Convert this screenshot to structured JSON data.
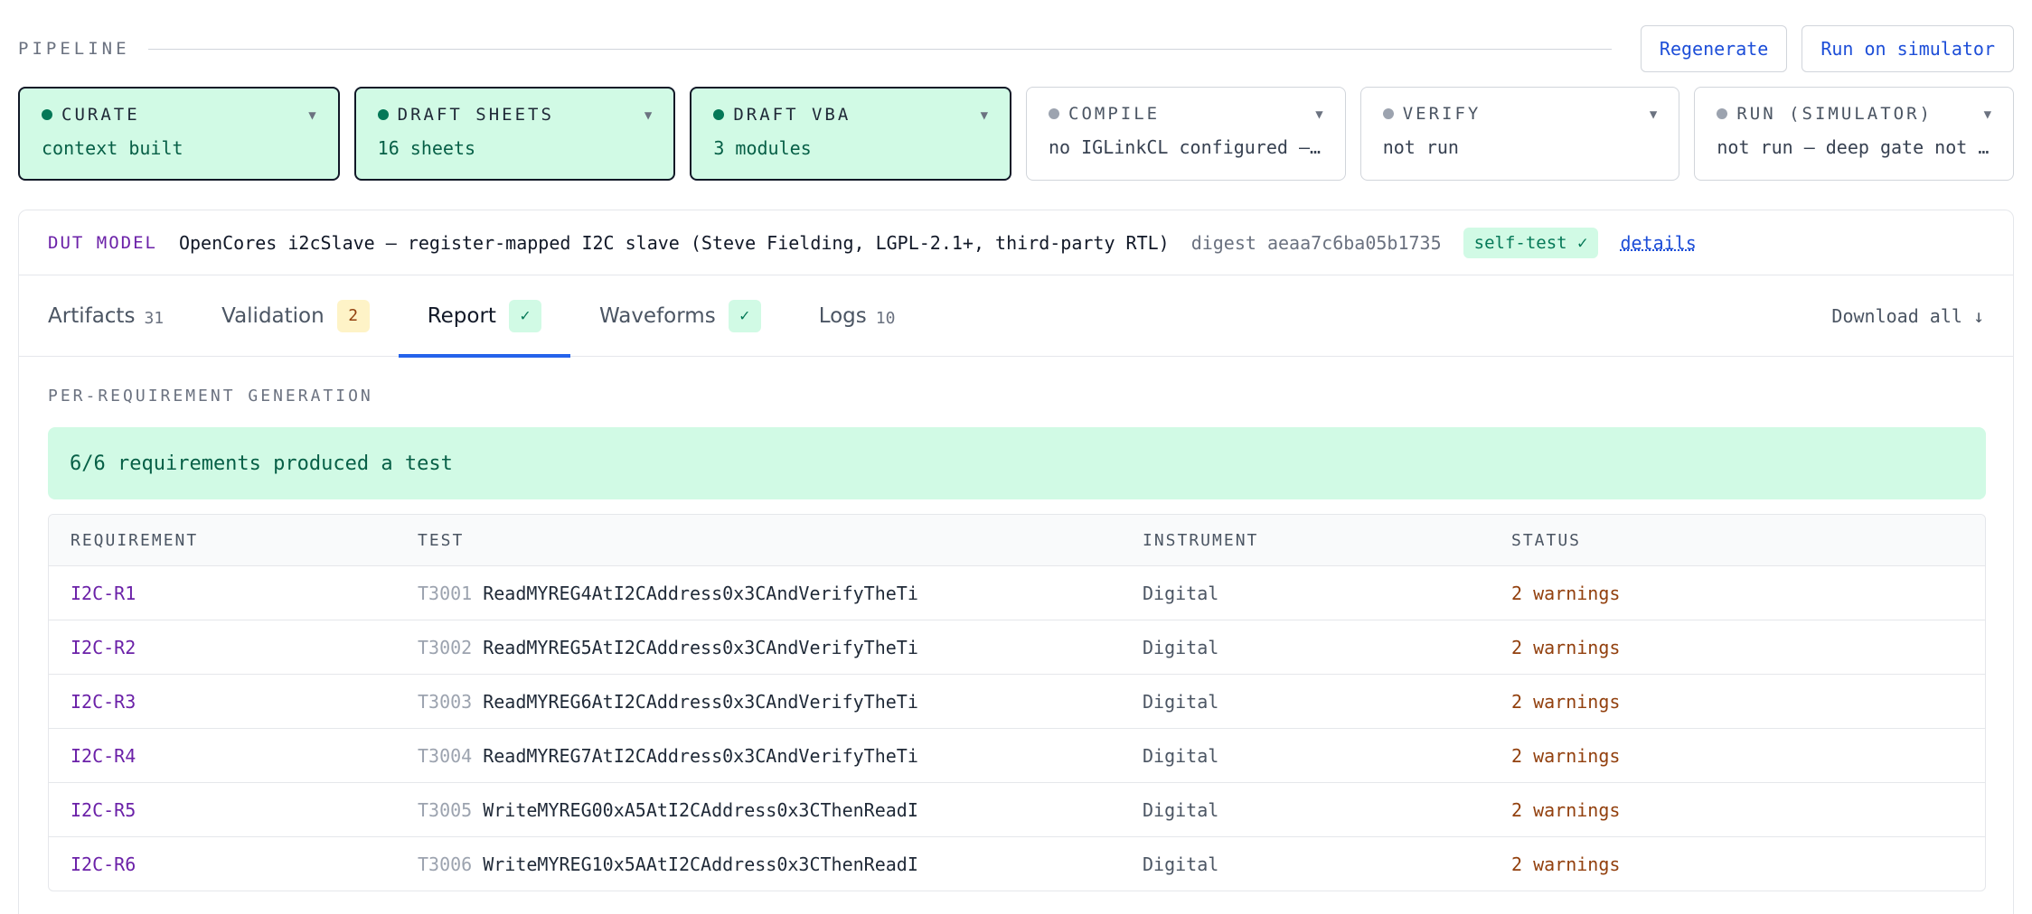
{
  "pipeline": {
    "label": "PIPELINE",
    "regenerate_label": "Regenerate",
    "run_label": "Run on simulator"
  },
  "stages": [
    {
      "name": "CURATE",
      "sub": "context built",
      "state": "done"
    },
    {
      "name": "DRAFT SHEETS",
      "sub": "16 sheets",
      "state": "done"
    },
    {
      "name": "DRAFT VBA",
      "sub": "3 modules",
      "state": "done"
    },
    {
      "name": "COMPILE",
      "sub": "no IGLinkCL configured —…",
      "state": "pending"
    },
    {
      "name": "VERIFY",
      "sub": "not run",
      "state": "pending"
    },
    {
      "name": "RUN (SIMULATOR)",
      "sub": "not run — deep gate not …",
      "state": "pending"
    }
  ],
  "dut": {
    "label": "DUT MODEL",
    "name": "OpenCores i2cSlave — register-mapped I2C slave (Steve Fielding, LGPL-2.1+, third-party RTL)",
    "digest": "digest aeaa7c6ba05b1735",
    "selftest": "self-test ✓",
    "details_label": "details"
  },
  "tabs": [
    {
      "label": "Artifacts",
      "count": "31",
      "active": false
    },
    {
      "label": "Validation",
      "pill": "2",
      "pill_kind": "warn",
      "active": false
    },
    {
      "label": "Report",
      "pill": "✓",
      "pill_kind": "ok",
      "active": true
    },
    {
      "label": "Waveforms",
      "pill": "✓",
      "pill_kind": "ok",
      "active": false
    },
    {
      "label": "Logs",
      "count": "10",
      "active": false
    }
  ],
  "download_label": "Download all ↓",
  "report": {
    "section_label": "PER-REQUIREMENT GENERATION",
    "summary": "6/6 requirements produced a test",
    "columns": [
      "REQUIREMENT",
      "TEST",
      "INSTRUMENT",
      "STATUS"
    ],
    "rows": [
      {
        "req": "I2C-R1",
        "tid": "T3001",
        "tname": "ReadMYREG4AtI2CAddress0x3CAndVerifyTheTi",
        "instrument": "Digital",
        "status": "2 warnings"
      },
      {
        "req": "I2C-R2",
        "tid": "T3002",
        "tname": "ReadMYREG5AtI2CAddress0x3CAndVerifyTheTi",
        "instrument": "Digital",
        "status": "2 warnings"
      },
      {
        "req": "I2C-R3",
        "tid": "T3003",
        "tname": "ReadMYREG6AtI2CAddress0x3CAndVerifyTheTi",
        "instrument": "Digital",
        "status": "2 warnings"
      },
      {
        "req": "I2C-R4",
        "tid": "T3004",
        "tname": "ReadMYREG7AtI2CAddress0x3CAndVerifyTheTi",
        "instrument": "Digital",
        "status": "2 warnings"
      },
      {
        "req": "I2C-R5",
        "tid": "T3005",
        "tname": "WriteMYREG00xA5AtI2CAddress0x3CThenReadI",
        "instrument": "Digital",
        "status": "2 warnings"
      },
      {
        "req": "I2C-R6",
        "tid": "T3006",
        "tname": "WriteMYREG10x5AAtI2CAddress0x3CThenReadI",
        "instrument": "Digital",
        "status": "2 warnings"
      }
    ]
  }
}
